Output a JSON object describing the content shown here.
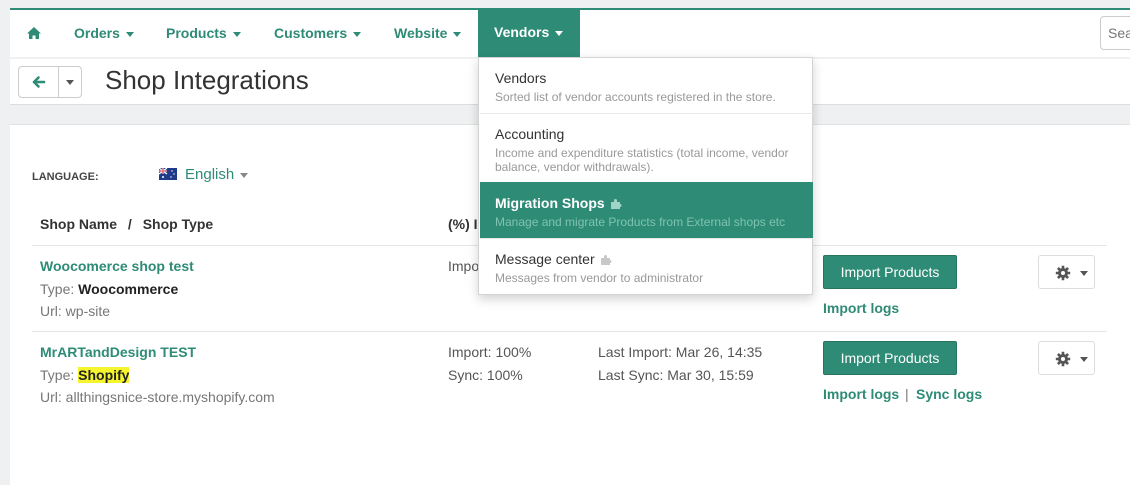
{
  "nav": {
    "home_icon": "home-icon",
    "items": [
      {
        "label": "Orders"
      },
      {
        "label": "Products"
      },
      {
        "label": "Customers"
      },
      {
        "label": "Website"
      }
    ],
    "active": {
      "label": "Vendors"
    },
    "search_placeholder": "Search"
  },
  "titlebar": {
    "title": "Shop Integrations"
  },
  "language": {
    "label": "LANGUAGE:",
    "value": "English"
  },
  "table": {
    "headers": {
      "shop_name": "Shop Name",
      "separator": "/",
      "shop_type": "Shop Type",
      "percent": "(%) I"
    },
    "rows": [
      {
        "name": "Woocomerce shop test",
        "type_label": "Type:",
        "type_value": "Woocommerce",
        "url_label": "Url:",
        "url_value": "wp-site",
        "import_status": "Impo",
        "import_button": "Import Products",
        "import_logs": "Import logs"
      },
      {
        "name": "MrARTandDesign TEST",
        "type_label": "Type:",
        "type_value": "Shopify",
        "url_label": "Url:",
        "url_value": "allthingsnice-store.myshopify.com",
        "import_status": "Import: 100%",
        "sync_status": "Sync: 100%",
        "last_import": "Last Import: Mar 26, 14:35",
        "last_sync": "Last Sync: Mar 30, 15:59",
        "import_button": "Import Products",
        "import_logs": "Import logs",
        "link_separator": "|",
        "sync_logs": "Sync logs"
      }
    ]
  },
  "dropdown": {
    "items": [
      {
        "title": "Vendors",
        "desc": "Sorted list of vendor accounts registered in the store."
      },
      {
        "title": "Accounting",
        "desc": "Income and expenditure statistics (total income, vendor balance, vendor withdrawals)."
      },
      {
        "title": "Migration Shops",
        "desc": "Manage and migrate Products from External shops etc"
      },
      {
        "title": "Message center",
        "desc": "Messages from vendor to administrator"
      }
    ]
  },
  "colors": {
    "accent": "#2e8b76",
    "highlight": "#f6f42d"
  }
}
